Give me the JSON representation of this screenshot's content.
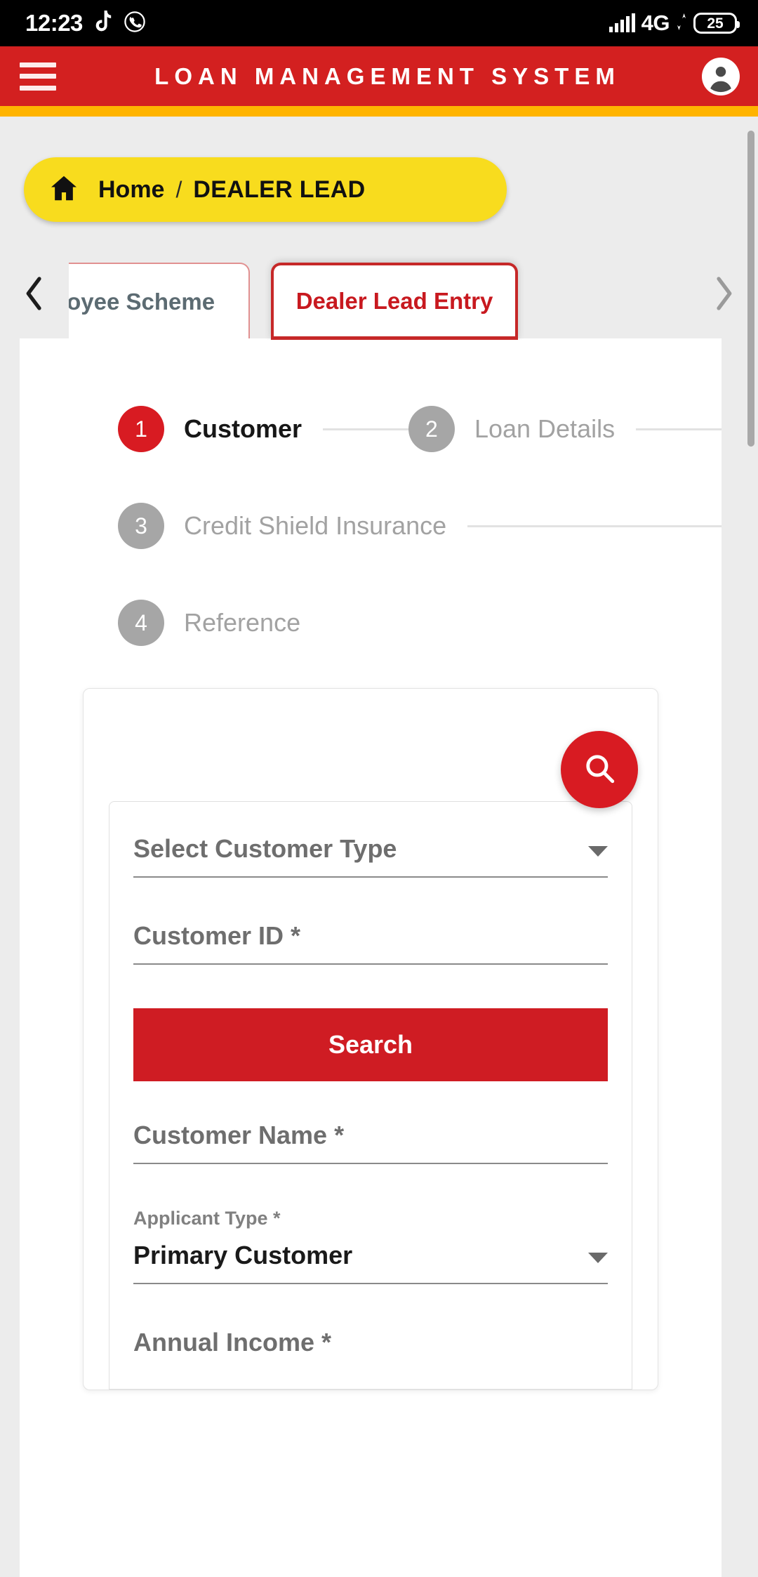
{
  "status_bar": {
    "time": "12:23",
    "icons": [
      "tiktok-icon",
      "whatsapp-icon"
    ],
    "network": "4G",
    "battery": "25"
  },
  "app_bar": {
    "title": "LOAN MANAGEMENT SYSTEM",
    "menu_icon": "hamburger-menu-icon",
    "account_icon": "account-circle-icon"
  },
  "breadcrumb": {
    "home_icon": "home-icon",
    "home": "Home",
    "separator": "/",
    "current": "DEALER LEAD"
  },
  "tabs": {
    "prev_arrow": "chevron-left-icon",
    "next_arrow": "chevron-right-icon",
    "items": [
      {
        "label": "loyee Scheme",
        "active": false
      },
      {
        "label": "Dealer Lead Entry",
        "active": true
      }
    ]
  },
  "stepper": {
    "steps": [
      {
        "number": "1",
        "label": "Customer",
        "active": true
      },
      {
        "number": "2",
        "label": "Loan Details",
        "active": false
      },
      {
        "number": "3",
        "label": "Credit Shield Insurance",
        "active": false
      },
      {
        "number": "4",
        "label": "Reference",
        "active": false
      }
    ]
  },
  "form": {
    "fab_icon": "search-icon",
    "customer_type": {
      "placeholder": "Select Customer Type",
      "value": ""
    },
    "customer_id": {
      "placeholder": "Customer ID *",
      "value": ""
    },
    "search_button": "Search",
    "customer_name": {
      "placeholder": "Customer Name *",
      "value": ""
    },
    "applicant_type": {
      "label": "Applicant Type *",
      "value": "Primary Customer"
    },
    "annual_income": {
      "label": "Annual Income *"
    }
  },
  "colors": {
    "brand_red": "#d32020",
    "accent_yellow": "#ffb400",
    "breadcrumb_yellow": "#f8dc1e",
    "active_step": "#d81b22",
    "idle_gray": "#a6a6a6"
  }
}
